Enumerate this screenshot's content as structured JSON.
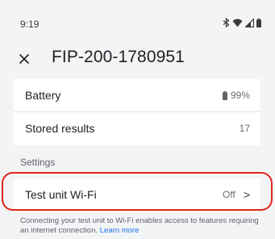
{
  "status_bar": {
    "time": "9:19",
    "icons": [
      "bluetooth-icon",
      "wifi-signal-icon",
      "cell-signal-icon",
      "battery-status-icon"
    ]
  },
  "header": {
    "close_icon": "close-icon",
    "title": "FIP-200-1780951"
  },
  "info_rows": [
    {
      "label": "Battery",
      "value": "99%",
      "icon": "battery-icon"
    },
    {
      "label": "Stored results",
      "value": "17"
    }
  ],
  "settings": {
    "section_label": "Settings",
    "wifi": {
      "label": "Test unit Wi-Fi",
      "value": "Off",
      "chevron": ">"
    }
  },
  "footer": {
    "info_text": "Connecting your test unit to Wi-Fi enables access to features requiring an internet connection.",
    "link_text": "Learn more"
  },
  "colors": {
    "background": "#f3f4f6",
    "card": "#ffffff",
    "highlight": "#e0251c",
    "link": "#1a73e8"
  }
}
